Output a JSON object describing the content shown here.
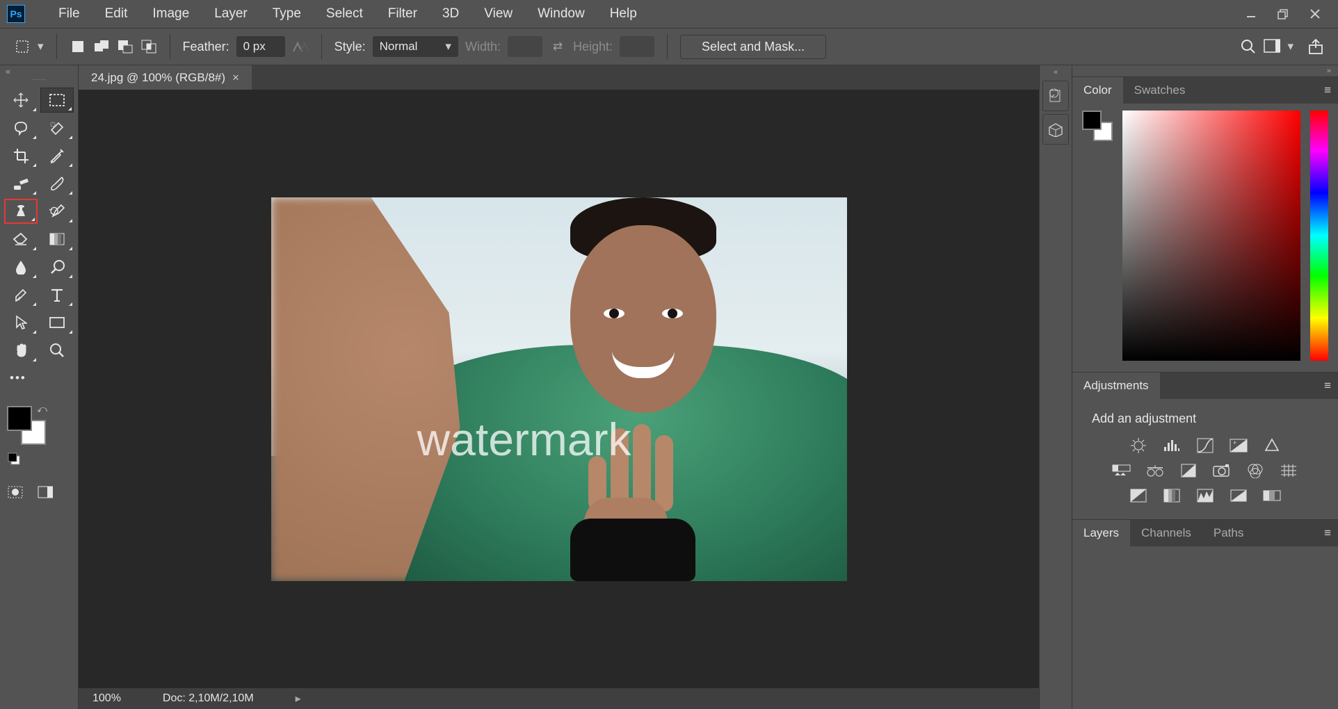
{
  "app": {
    "menus": [
      "File",
      "Edit",
      "Image",
      "Layer",
      "Type",
      "Select",
      "Filter",
      "3D",
      "View",
      "Window",
      "Help"
    ]
  },
  "optionbar": {
    "feather_label": "Feather:",
    "feather_value": "0 px",
    "style_label": "Style:",
    "style_value": "Normal",
    "width_label": "Width:",
    "width_value": "",
    "height_label": "Height:",
    "height_value": "",
    "select_mask_btn": "Select and Mask..."
  },
  "document": {
    "tab_title": "24.jpg @ 100% (RGB/8#)",
    "watermark_text": "watermark"
  },
  "statusbar": {
    "zoom": "100%",
    "doc_info": "Doc: 2,10M/2,10M"
  },
  "panels": {
    "color_tab": "Color",
    "swatches_tab": "Swatches",
    "adjustments_tab": "Adjustments",
    "add_adjustment_label": "Add an adjustment",
    "layers_tab": "Layers",
    "channels_tab": "Channels",
    "paths_tab": "Paths"
  }
}
